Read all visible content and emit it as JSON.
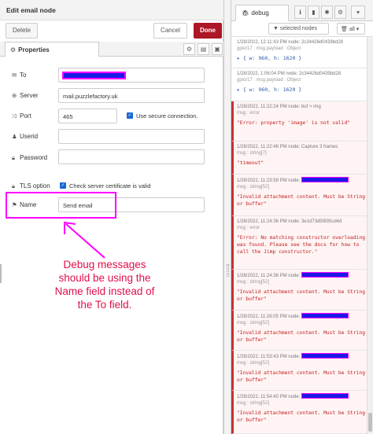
{
  "editor": {
    "title": "Edit email node",
    "delete_label": "Delete",
    "cancel_label": "Cancel",
    "done_label": "Done",
    "tab_label": "Properties",
    "fields": {
      "to_label": "To",
      "server_label": "Server",
      "server_value": "mail.puzzlefactory.uk",
      "port_label": "Port",
      "port_value": "465",
      "secure_label": "Use secure connection.",
      "userid_label": "Userid",
      "password_label": "Password",
      "tls_label": "TLS option",
      "tls_check_label": "Check server certificate is valid",
      "name_label": "Name",
      "name_value": "Send email"
    }
  },
  "annotation": {
    "line1": "Debug messages",
    "line2": "should be using the",
    "line3": "Name field instead of",
    "line4": "the To field."
  },
  "debug": {
    "tab_label": "debug",
    "filter_label": "selected nodes",
    "clear_label": "all",
    "messages": [
      {
        "meta": "1/28/2022, 12:11:43 PM   node: 2c34426d0439bd28",
        "meta2": "gpio/17 : msg.payload : Object",
        "body": "{ w: 960, h: 1620 }",
        "error": false
      },
      {
        "meta": "1/28/2022, 1:06:04 PM   node: 2c34426d0439bd28",
        "meta2": "gpio/17 : msg.payload : Object",
        "body": "{ w: 960, h: 1620 }",
        "error": false
      },
      {
        "meta": "1/28/2022, 11:22:24 PM   node: buf > img",
        "meta2": "msg : error",
        "body": "\"Error: property 'image' is not valid\"",
        "error": true
      },
      {
        "meta": "1/28/2022, 11:22:48 PM   node: Capture 3 frames",
        "meta2": "msg : string[7]",
        "body": "\"timeout\"",
        "error": true
      },
      {
        "meta": "1/28/2022, 11:23:58 PM   node:",
        "meta2": "msg : string[52]",
        "body": "\"Invalid attachment content. Must be String or buffer\"",
        "error": true
      },
      {
        "meta": "1/28/2022, 11:24:36 PM   node: 3e1d73d5f835cd4d",
        "meta2": "msg : error",
        "body": "\"Error: No matching constructor overloading was found. Please see the docs for how to call the Jimp constructor.\"",
        "error": true
      },
      {
        "meta": "1/28/2022, 11:24:36 PM   node:",
        "meta2": "msg : string[52]",
        "body": "\"Invalid attachment content. Must be String or buffer\"",
        "error": true
      },
      {
        "meta": "1/28/2022, 11:26:05 PM   node:",
        "meta2": "msg : string[52]",
        "body": "\"Invalid attachment content. Must be String or buffer\"",
        "error": true
      },
      {
        "meta": "1/28/2022, 11:53:43 PM   node:",
        "meta2": "msg : string[52]",
        "body": "\"Invalid attachment content. Must be String or buffer\"",
        "error": true
      },
      {
        "meta": "1/28/2022, 11:54:40 PM   node:",
        "meta2": "msg : string[52]",
        "body": "\"Invalid attachment content. Must be String or buffer\"",
        "error": true
      }
    ]
  },
  "colors": {
    "done_button": "#ad1625",
    "highlight": "#ff00ff",
    "redaction": "#1a1ae6",
    "annotation": "#e0104a",
    "error_bar": "#c82f35",
    "error_text": "#c02020"
  }
}
